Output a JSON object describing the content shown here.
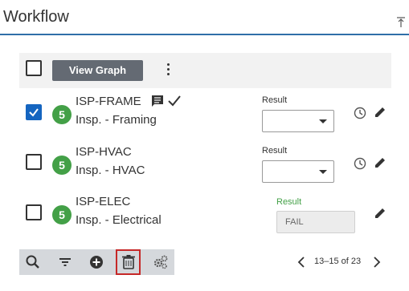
{
  "header": {
    "title": "Workflow"
  },
  "toolbar": {
    "view_graph_label": "View Graph"
  },
  "rows": [
    {
      "count": "5",
      "code": "ISP-FRAME",
      "description": "Insp. - Framing",
      "result_label": "Result",
      "result_value": "",
      "checked": true
    },
    {
      "count": "5",
      "code": "ISP-HVAC",
      "description": "Insp. - HVAC",
      "result_label": "Result",
      "result_value": "",
      "checked": false
    },
    {
      "count": "5",
      "code": "ISP-ELEC",
      "description": "Insp. - Electrical",
      "result_label": "Result",
      "result_value": "FAIL",
      "checked": false
    }
  ],
  "pager": {
    "range_text": "13–15 of 23"
  },
  "icons": {
    "bottom_bar": [
      "search-icon",
      "filter-icon",
      "add-icon",
      "trash-icon",
      "settings-icon"
    ],
    "row_actions": [
      "history-icon",
      "edit-icon"
    ]
  },
  "colors": {
    "accent": "#2f6fa8",
    "badge": "#43a047",
    "checkbox_checked": "#1565c0",
    "highlight": "#c62828"
  }
}
